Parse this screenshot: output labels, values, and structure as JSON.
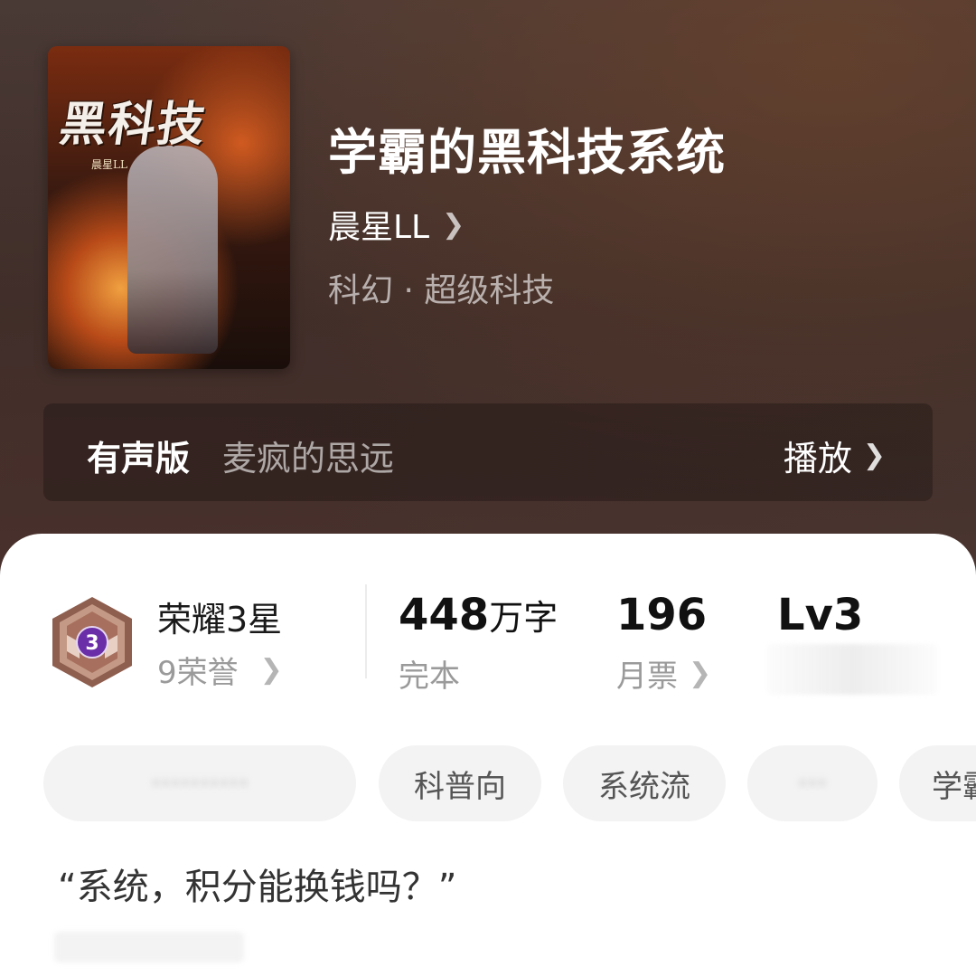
{
  "book": {
    "title": "学霸的黑科技系统",
    "author": "晨星LL",
    "genre": "科幻 · 超级科技",
    "cover": {
      "title_art": "黑科技",
      "author_art": "晨星LL"
    }
  },
  "audio": {
    "label": "有声版",
    "narrator": "麦疯的思远",
    "action": "播放"
  },
  "stats": {
    "honor_title": "荣耀3星",
    "honor_level": "3",
    "honor_count": "9荣誉",
    "word_count": "448",
    "word_unit": "万字",
    "status": "完本",
    "monthly_tickets": "196",
    "monthly_label": "月票",
    "level": "Lv3"
  },
  "tags": [
    "科普向",
    "系统流",
    "学霸"
  ],
  "quote": "“系统，积分能换钱吗？”",
  "colors": {
    "badge_purple": "#6a2fa8",
    "badge_bronze": "#9a6a58",
    "panel_bg": "#ffffff",
    "tag_bg": "#f3f3f3"
  },
  "icons": [
    "chevron-right-icon",
    "honor-badge-icon"
  ]
}
